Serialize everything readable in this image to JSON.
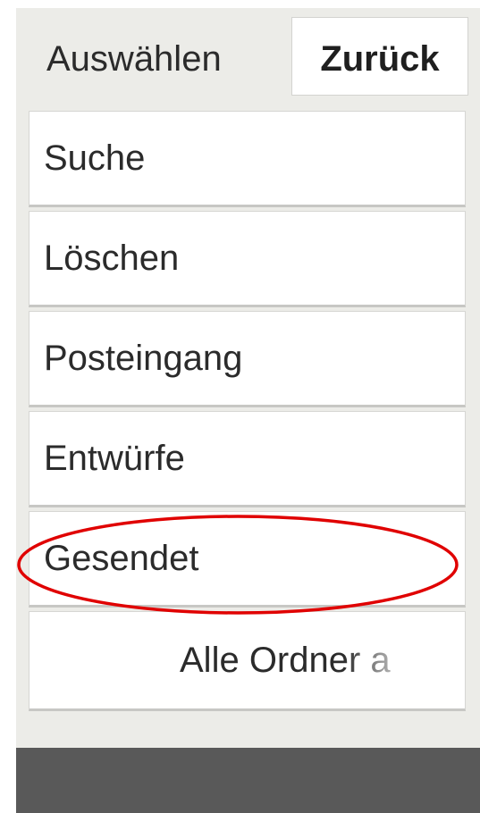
{
  "header": {
    "title": "Auswählen",
    "back_label": "Zurück"
  },
  "menu": {
    "items": [
      {
        "label": "Suche"
      },
      {
        "label": "Löschen"
      },
      {
        "label": "Posteingang"
      },
      {
        "label": "Entwürfe"
      },
      {
        "label": "Gesendet"
      }
    ],
    "all_folders_label": "Alle Ordner a"
  },
  "annotation": {
    "highlight_color": "#e00000"
  },
  "colors": {
    "panel_bg": "#ecece8",
    "item_bg": "#ffffff",
    "bottom_bar": "#595959"
  }
}
